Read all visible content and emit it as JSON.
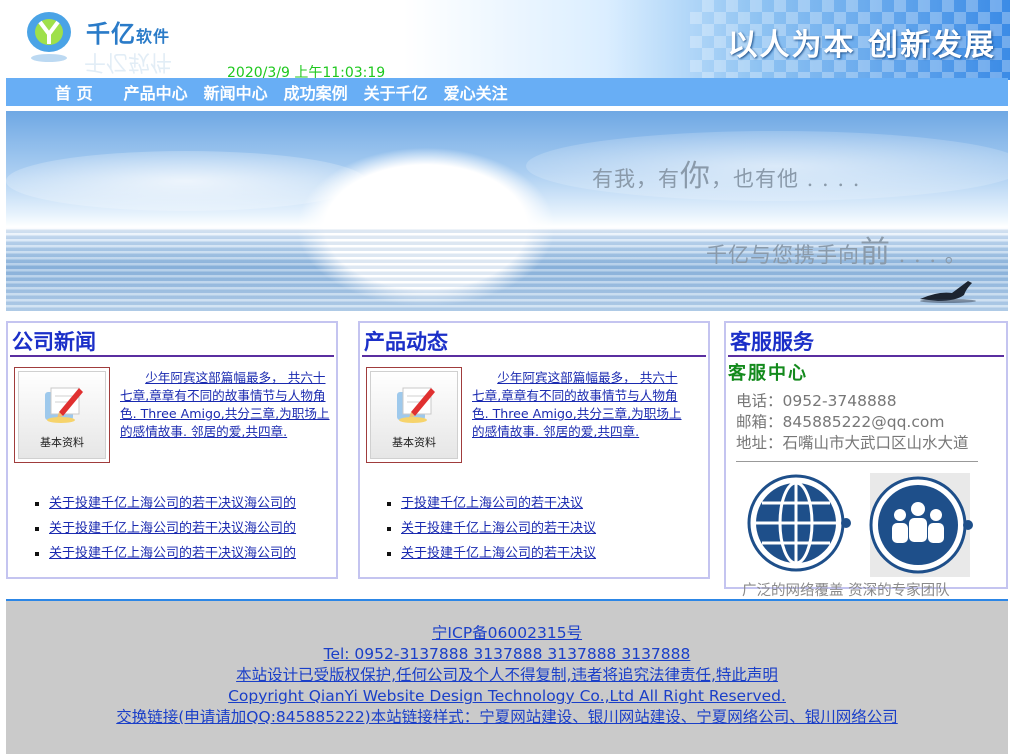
{
  "header": {
    "logo_text_main": "千亿",
    "logo_text_sub": "软件",
    "logo_ghost": "千亿软件",
    "datetime": "2020/3/9 上午11:03:19",
    "slogan": "以人为本 创新发展"
  },
  "nav": {
    "items": [
      "首 页",
      "产品中心",
      "新闻中心",
      "成功案例",
      "关于千亿",
      "爱心关注"
    ]
  },
  "banner": {
    "line1_a": "有我，有",
    "line1_big": "你",
    "line1_b": "，也有他 . . . .",
    "line2_a": "千亿与您携手向",
    "line2_big": "前",
    "line2_b": " . . . 。"
  },
  "news": {
    "title": "公司新闻",
    "thumb_label": "基本资料",
    "description": "少年阿宾这部篇幅最多， 共六十七章,章章有不同的故事情节与人物角色. Three Amigo,共分三章,为职场上的感情故事. 邻居的爱,共四章.",
    "links": [
      "关于投建千亿上海公司的若干决议海公司的",
      "关于投建千亿上海公司的若干决议海公司的",
      "关于投建千亿上海公司的若干决议海公司的"
    ]
  },
  "products": {
    "title": "产品动态",
    "thumb_label": "基本资料",
    "description": "少年阿宾这部篇幅最多， 共六十七章,章章有不同的故事情节与人物角色. Three Amigo,共分三章,为职场上的感情故事. 邻居的爱,共四章.",
    "links": [
      "于投建千亿上海公司的若干决议",
      "关于投建千亿上海公司的若干决议",
      "关于投建千亿上海公司的若干决议"
    ]
  },
  "service": {
    "title": "客服服务",
    "subtitle": "客服中心",
    "phone": "电话：0952-3748888",
    "email": "邮箱：845885222@qq.com",
    "address": "地址：石嘴山市大武口区山水大道",
    "caption": "广泛的网络覆盖  资深的专家团队"
  },
  "footer": {
    "icp": "宁ICP备06002315号",
    "tel": "Tel: 0952-3137888 3137888 3137888 3137888",
    "copyright_notice": "本站设计已受版权保护,任何公司及个人不得复制,违者将追究法律责任,特此声明",
    "copyright": "Copyright QianYi Website Design Technology Co.,Ltd All Right Reserved.",
    "exchange": "交换链接(申请请加QQ:845885222)本站链接样式：宁夏网站建设、银川网站建设、宁夏网络公司、银川网络公司"
  },
  "colors": {
    "nav_bg": "#68aef5",
    "heading_blue": "#1b2fc8",
    "link_blue": "#1a2ab0",
    "date_green": "#1ec81e",
    "footer_bg": "#cacaca",
    "footer_accent": "#2c86e6"
  }
}
